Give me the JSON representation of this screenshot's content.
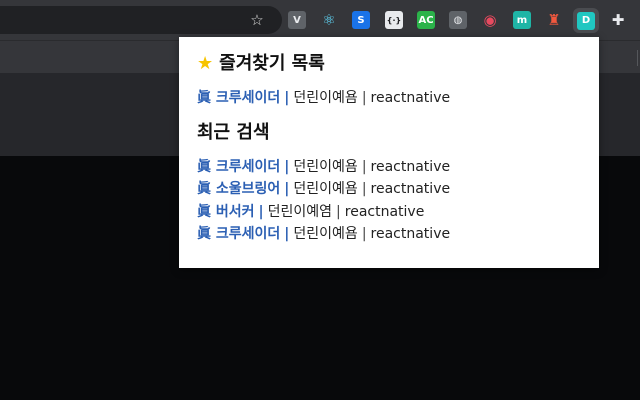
{
  "toolbar": {
    "star_glyph": "☆",
    "extensions": [
      {
        "name": "vuetify-icon",
        "glyph": "V",
        "bg": "#5f6368",
        "fg": "#e8eaed"
      },
      {
        "name": "react-devtools-icon",
        "glyph": "⚛",
        "bg": "transparent",
        "fg": "#61dafb"
      },
      {
        "name": "s-extension-icon",
        "glyph": "S",
        "bg": "#1a73e8",
        "fg": "#ffffff"
      },
      {
        "name": "dictionary-icon",
        "glyph": "{·}",
        "bg": "#e8eaed",
        "fg": "#202124"
      },
      {
        "name": "ac-icon",
        "glyph": "AC",
        "bg": "#2bb34a",
        "fg": "#ffffff"
      },
      {
        "name": "lightbulb-icon",
        "glyph": "◍",
        "bg": "#5f6368",
        "fg": "#e8eaed"
      },
      {
        "name": "color-wheel-icon",
        "glyph": "◉",
        "bg": "transparent",
        "fg": "#e84a5f"
      },
      {
        "name": "m-extension-icon",
        "glyph": "m",
        "bg": "#1fb5a6",
        "fg": "#ffffff"
      },
      {
        "name": "lighthouse-icon",
        "glyph": "♜",
        "bg": "transparent",
        "fg": "#f2583e"
      },
      {
        "name": "dunrini-extension-icon",
        "glyph": "D",
        "bg": "#20c7c1",
        "fg": "#ffffff"
      },
      {
        "name": "puzzle-extensions-icon",
        "glyph": "✚",
        "bg": "transparent",
        "fg": "#e8eaed"
      }
    ]
  },
  "popup": {
    "favorites_title": "즐겨찾기 목록",
    "favorites": [
      {
        "name": "眞 크루세이더",
        "author": "던린이예욤",
        "tag": "reactnative"
      }
    ],
    "recent_title": "최근 검색",
    "recent": [
      {
        "name": "眞 크루세이더",
        "author": "던린이예욤",
        "tag": "reactnative"
      },
      {
        "name": "眞 소울브링어",
        "author": "던린이예욤",
        "tag": "reactnative"
      },
      {
        "name": "眞 버서커",
        "author": "던린이예염",
        "tag": "reactnative"
      },
      {
        "name": "眞 크루세이더",
        "author": "던린이예욤",
        "tag": "reactnative"
      }
    ],
    "separator": "|"
  }
}
